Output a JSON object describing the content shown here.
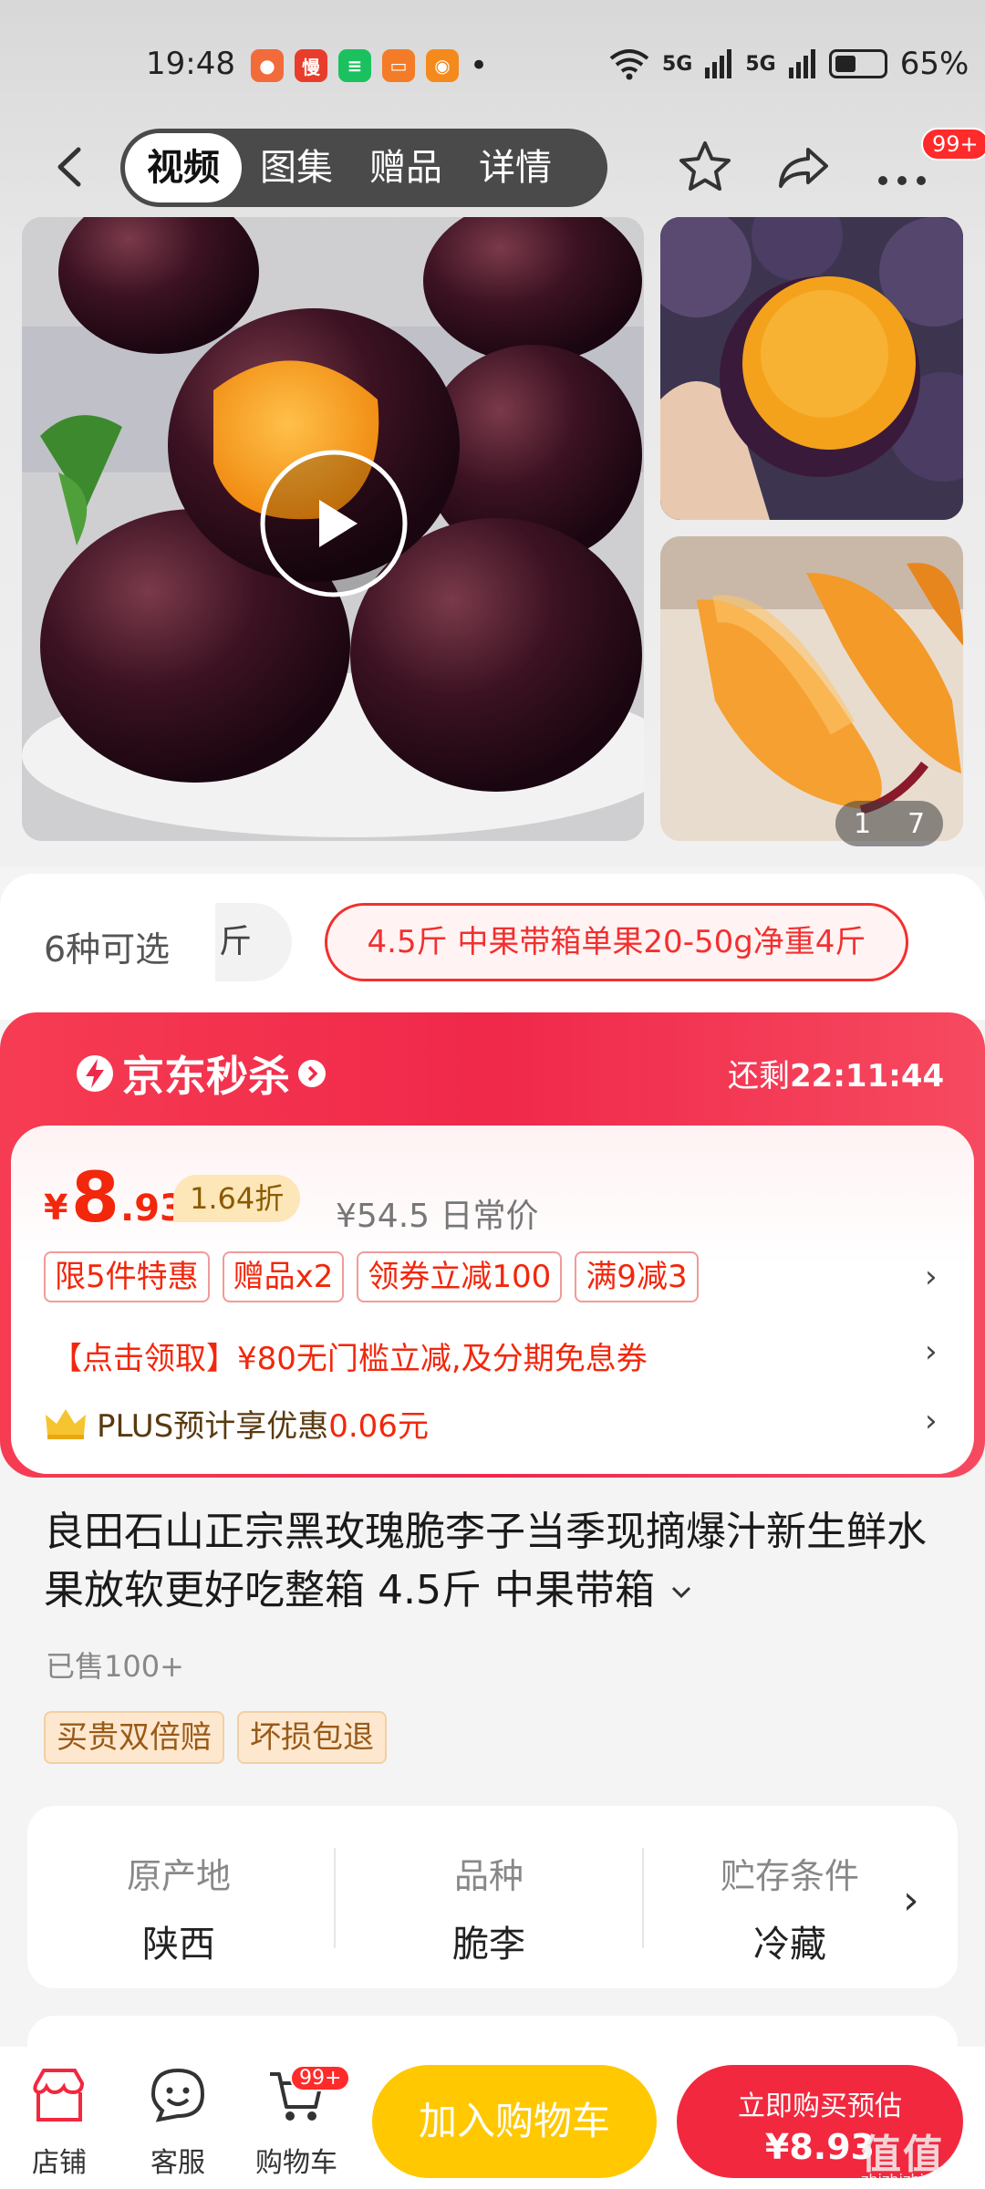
{
  "status_bar": {
    "time": "19:48",
    "apps": [
      {
        "name": "app-icon-1",
        "glyph": "●",
        "color": "#f26b3a"
      },
      {
        "name": "app-icon-2",
        "glyph": "慢",
        "color": "#e83c2c"
      },
      {
        "name": "app-icon-3",
        "glyph": "≡",
        "color": "#1bc15e"
      },
      {
        "name": "app-icon-4",
        "glyph": "▭",
        "color": "#f47b27"
      },
      {
        "name": "app-icon-5",
        "glyph": "◉",
        "color": "#f58a1c"
      }
    ],
    "dot": "•",
    "signal1": "5G",
    "signal2": "5G",
    "battery": "65%"
  },
  "nav": {
    "tabs": [
      "视频",
      "图集",
      "赠品",
      "详情"
    ],
    "active_tab": 0,
    "more_badge": "99+"
  },
  "gallery": {
    "counter_current": "1",
    "counter_total": "7"
  },
  "variant": {
    "count_label": "6种可选",
    "partial_chip": "斤",
    "selected_chip": "4.5斤 中果带箱单果20-50g净重4斤"
  },
  "flash_sale": {
    "logo_text": "京东秒杀",
    "remain_label": "还剩",
    "remain_time": "22:11:44",
    "price_yen": "¥",
    "price_int": "8",
    "price_dec": ".93",
    "discount": "1.64折",
    "orig_price": "¥54.5 日常价",
    "promo_tags": [
      "限5件特惠",
      "赠品x2",
      "领券立减100",
      "满9减3"
    ],
    "coupon_text": "【点击领取】¥80无门槛立减,及分期免息券",
    "plus_prefix": "PLUS预计享优惠",
    "plus_amount": "0.06元"
  },
  "product": {
    "title": "良田石山正宗黑玫瑰脆李子当季现摘爆汁新生鲜水果放软更好吃整箱 4.5斤 中果带箱",
    "sold": "已售100+",
    "service_tags": [
      "买贵双倍赔",
      "坏损包退"
    ]
  },
  "attributes": [
    {
      "key": "原产地",
      "value": "陕西"
    },
    {
      "key": "品种",
      "value": "脆李"
    },
    {
      "key": "贮存条件",
      "value": "冷藏"
    }
  ],
  "bottom_bar": {
    "store": "店铺",
    "service": "客服",
    "cart": "购物车",
    "cart_badge": "99+",
    "add_to_cart": "加入购物车",
    "buy_now_line1": "立即购买预估",
    "buy_now_line2": "¥8.93"
  },
  "watermark": {
    "logo": "值值值",
    "url": "zhizhizhi.com"
  },
  "colors": {
    "accent_red": "#f2270c",
    "flash_red": "#f0284a",
    "cart_yellow": "#ffc800"
  }
}
